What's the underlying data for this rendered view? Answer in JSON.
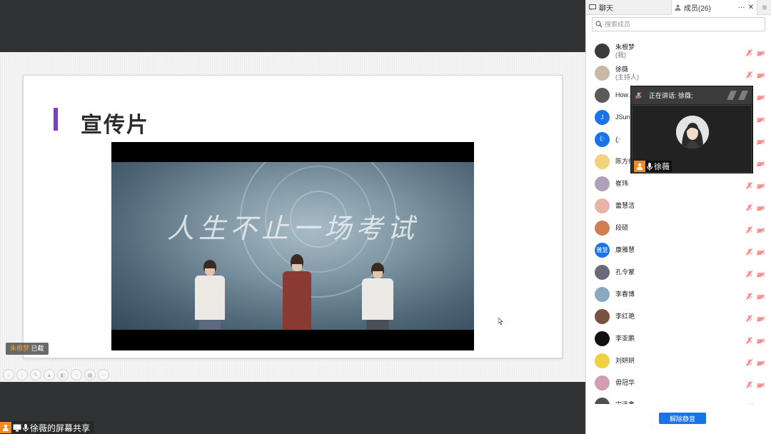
{
  "share": {
    "slide_title": "宣传片",
    "video_caption": "人生不止一场考试",
    "name_badge_name": "朱根梦",
    "name_badge_status": "已截",
    "share_label": "徐薇的屏幕共享"
  },
  "panel": {
    "tab_chat": "聊天",
    "tab_members": "成员(26)",
    "tab_more": "···",
    "tab_close": "✕",
    "tab_menu": "≡",
    "search_placeholder": "搜索成员",
    "unmute_label": "解除静音"
  },
  "members": [
    {
      "name": "朱根梦",
      "role": "(我)",
      "avatar_color": "#3b3b3b",
      "avatar_text": ""
    },
    {
      "name": "徐薇",
      "role": "(主持人)",
      "avatar_color": "#c9b8a8",
      "avatar_text": ""
    },
    {
      "name": "How…",
      "role": "",
      "avatar_color": "#5a5a5a",
      "avatar_text": ""
    },
    {
      "name": "JSung",
      "role": "",
      "avatar_color": "#1a73e8",
      "avatar_text": "J"
    },
    {
      "name": "ꦿ",
      "role": "",
      "avatar_color": "#1a73e8",
      "avatar_text": "ꦿ"
    },
    {
      "name": "陈方伟",
      "role": "",
      "avatar_color": "#f2d27a",
      "avatar_text": ""
    },
    {
      "name": "崔玮",
      "role": "",
      "avatar_color": "#b0a0b8",
      "avatar_text": ""
    },
    {
      "name": "蕾慧洁",
      "role": "",
      "avatar_color": "#e8b4a8",
      "avatar_text": ""
    },
    {
      "name": "段硕",
      "role": "",
      "avatar_color": "#d08050",
      "avatar_text": ""
    },
    {
      "name": "康雅慧",
      "role": "",
      "avatar_color": "#1a73e8",
      "avatar_text": "雅慧"
    },
    {
      "name": "孔令蒙",
      "role": "",
      "avatar_color": "#6a6a7a",
      "avatar_text": ""
    },
    {
      "name": "李春博",
      "role": "",
      "avatar_color": "#8aa8c0",
      "avatar_text": ""
    },
    {
      "name": "李红艳",
      "role": "",
      "avatar_color": "#7a5040",
      "avatar_text": ""
    },
    {
      "name": "李亚鹏",
      "role": "",
      "avatar_color": "#111111",
      "avatar_text": ""
    },
    {
      "name": "刘妍妍",
      "role": "",
      "avatar_color": "#f0d040",
      "avatar_text": ""
    },
    {
      "name": "毋冠华",
      "role": "",
      "avatar_color": "#d0a0b0",
      "avatar_text": ""
    },
    {
      "name": "宋泽鑫",
      "role": "",
      "avatar_color": "#505050",
      "avatar_text": ""
    }
  ],
  "speaker": {
    "label": "正在讲话: 徐薇;",
    "name": "徐薇"
  },
  "colors": {
    "accent_purple": "#7b3fc4",
    "primary_blue": "#1a73e8",
    "muted_red": "#f06a6a",
    "orange": "#f08a24"
  }
}
